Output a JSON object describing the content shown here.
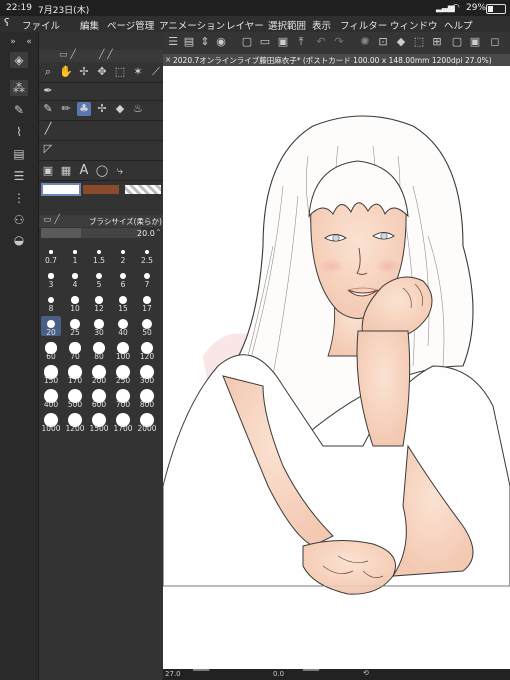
{
  "status": {
    "time": "22:19",
    "date": "7月23日(木)",
    "battery": "29%"
  },
  "menu": [
    "ファイル",
    "編集",
    "ページ管理",
    "アニメーション",
    "レイヤー",
    "選択範囲",
    "表示",
    "フィルター",
    "ウィンドウ",
    "ヘルプ"
  ],
  "document": {
    "title": "2020.7オンラインライブ藤田麻衣子* (ポストカード 100.00 x 148.00mm 1200dpi 27.0%)"
  },
  "brush": {
    "panel_title": "ブラシサイズ(柔らか)",
    "current_size": "20.0",
    "selected": "20",
    "sizes": [
      "0.7",
      "1",
      "1.5",
      "2",
      "2.5",
      "3",
      "4",
      "5",
      "6",
      "7",
      "8",
      "10",
      "12",
      "15",
      "17",
      "20",
      "25",
      "30",
      "40",
      "50",
      "60",
      "70",
      "80",
      "100",
      "120",
      "150",
      "170",
      "200",
      "250",
      "300",
      "400",
      "500",
      "600",
      "700",
      "800",
      "1000",
      "1200",
      "1500",
      "1700",
      "2000"
    ]
  },
  "colors": {
    "main": "#ffffff",
    "sub": "#8b4a2b",
    "accent": "#6b87b6"
  },
  "bottom": {
    "zoom": "27.0",
    "angle": "0.0"
  }
}
